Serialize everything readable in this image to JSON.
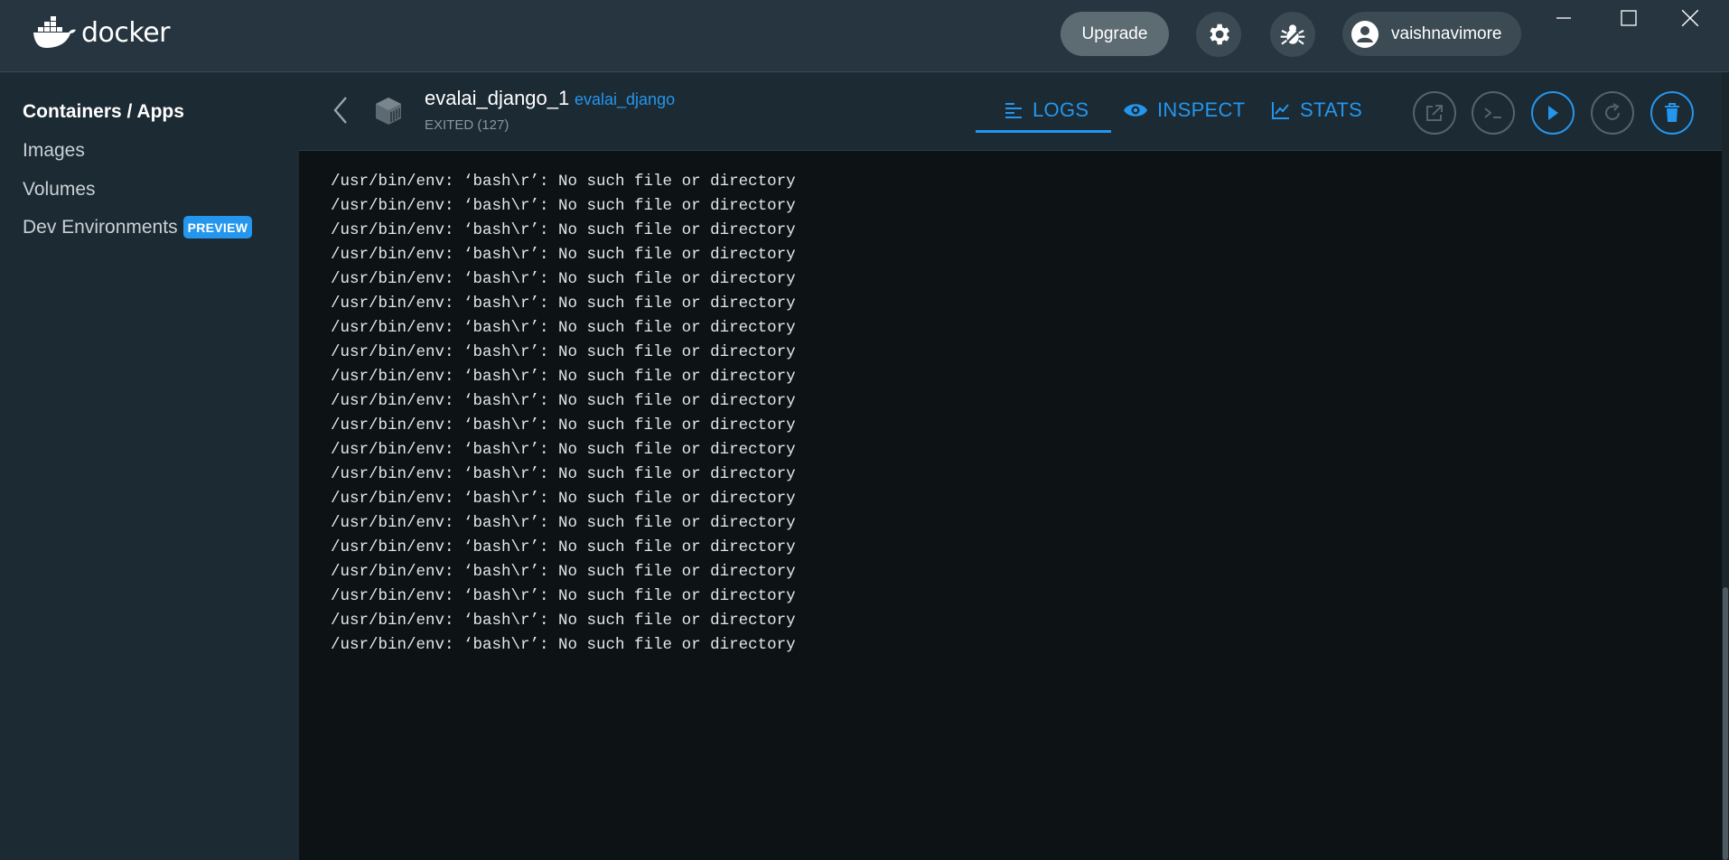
{
  "app": {
    "logo_text": "docker"
  },
  "titlebar": {
    "upgrade_label": "Upgrade",
    "settings_icon": "gear-icon",
    "bug_icon": "bug-icon",
    "user_name": "vaishnavimore"
  },
  "sidebar": {
    "items": [
      {
        "label": "Containers / Apps",
        "active": true
      },
      {
        "label": "Images"
      },
      {
        "label": "Volumes"
      },
      {
        "label": "Dev Environments",
        "badge": "PREVIEW"
      }
    ]
  },
  "container": {
    "name": "evalai_django_1",
    "image": "evalai_django",
    "status": "EXITED (127)"
  },
  "tabs": [
    {
      "label": "LOGS",
      "active": true
    },
    {
      "label": "INSPECT"
    },
    {
      "label": "STATS"
    }
  ],
  "colors": {
    "accent": "#2496ed",
    "titlebar": "#26353f",
    "sidebar": "#1c2a33",
    "log_bg": "#0d1214"
  },
  "logs": [
    "/usr/bin/env: ‘bash\\r’: No such file or directory",
    "/usr/bin/env: ‘bash\\r’: No such file or directory",
    "/usr/bin/env: ‘bash\\r’: No such file or directory",
    "/usr/bin/env: ‘bash\\r’: No such file or directory",
    "/usr/bin/env: ‘bash\\r’: No such file or directory",
    "/usr/bin/env: ‘bash\\r’: No such file or directory",
    "/usr/bin/env: ‘bash\\r’: No such file or directory",
    "/usr/bin/env: ‘bash\\r’: No such file or directory",
    "/usr/bin/env: ‘bash\\r’: No such file or directory",
    "/usr/bin/env: ‘bash\\r’: No such file or directory",
    "/usr/bin/env: ‘bash\\r’: No such file or directory",
    "/usr/bin/env: ‘bash\\r’: No such file or directory",
    "/usr/bin/env: ‘bash\\r’: No such file or directory",
    "/usr/bin/env: ‘bash\\r’: No such file or directory",
    "/usr/bin/env: ‘bash\\r’: No such file or directory",
    "/usr/bin/env: ‘bash\\r’: No such file or directory",
    "/usr/bin/env: ‘bash\\r’: No such file or directory",
    "/usr/bin/env: ‘bash\\r’: No such file or directory",
    "/usr/bin/env: ‘bash\\r’: No such file or directory",
    "/usr/bin/env: ‘bash\\r’: No such file or directory"
  ]
}
